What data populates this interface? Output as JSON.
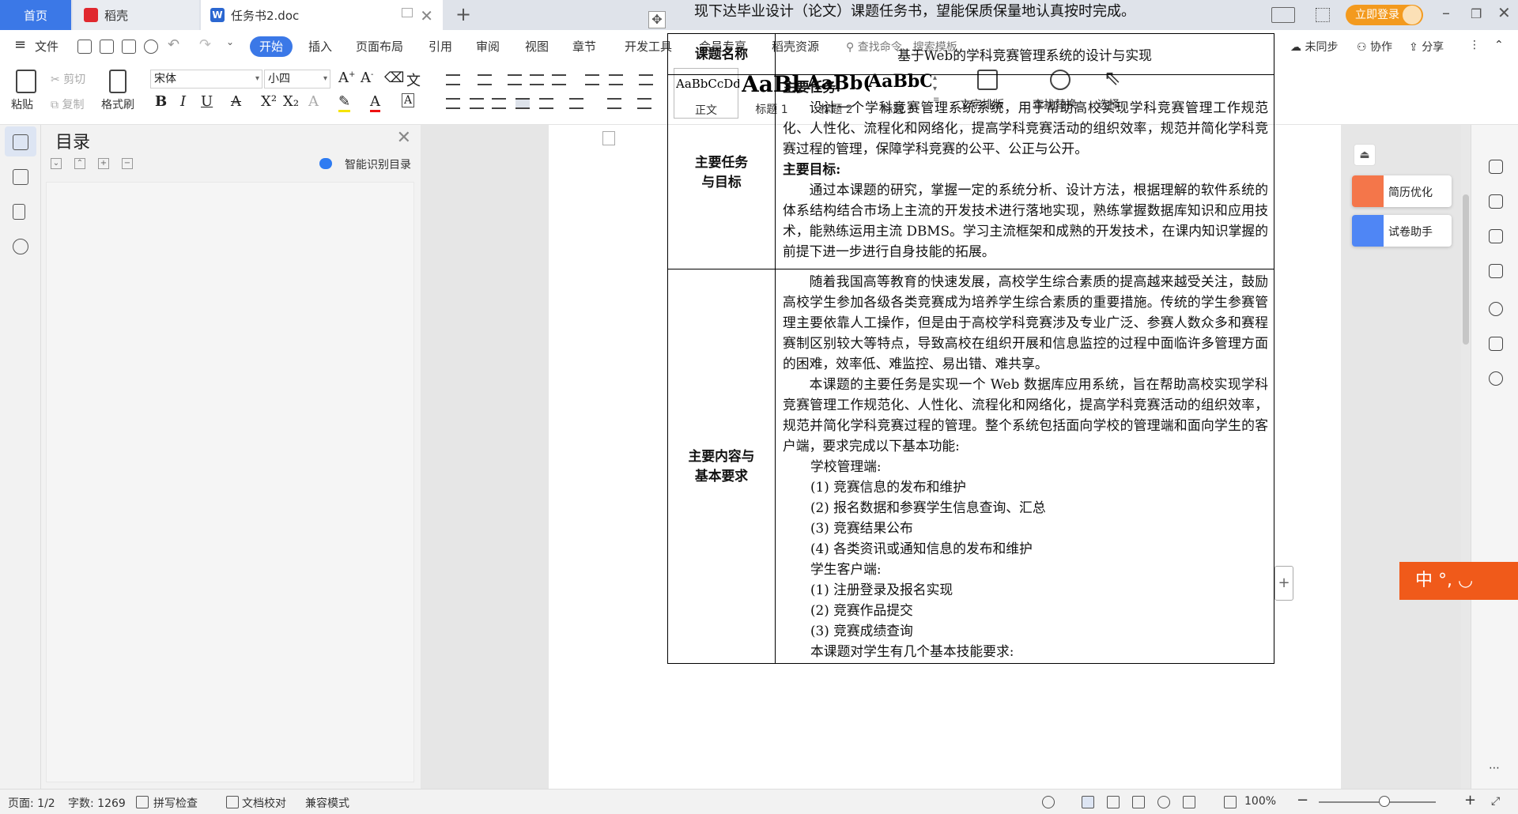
{
  "tabs": {
    "home": "首页",
    "daoke": "稻壳",
    "doc": "任务书2.doc",
    "login": "立即登录"
  },
  "menu": {
    "file": "文件",
    "items": [
      "开始",
      "插入",
      "页面布局",
      "引用",
      "审阅",
      "视图",
      "章节",
      "开发工具",
      "会员专享",
      "稻壳资源"
    ],
    "search_placeholder": "查找命令、搜索模板",
    "sync": "未同步",
    "collab": "协作",
    "share": "分享"
  },
  "ribbon": {
    "paste": "粘贴",
    "cut": "剪切",
    "copy": "复制",
    "format_painter": "格式刷",
    "font_name": "宋体",
    "font_size": "小四",
    "bold": "B",
    "italic": "I",
    "underline": "U",
    "styles": [
      {
        "sample": "AaBbCcDd",
        "caption": "正文"
      },
      {
        "sample": "AaBl",
        "caption": "标题 1"
      },
      {
        "sample": "AaBb(",
        "caption": "标题 2"
      },
      {
        "sample": "AaBbC",
        "caption": "标题 3"
      }
    ],
    "text_layout": "文字排版",
    "find_replace": "查找替换",
    "select": "选择"
  },
  "toc": {
    "title": "目录",
    "smart": "智能识别目录"
  },
  "document": {
    "intro_line": "现下达毕业设计（论文）课题任务书，望能保质保量地认真按时完成。",
    "rows": {
      "topic_label": "课题名称",
      "topic_value": "基于Web的学科竞赛管理系统的设计与实现",
      "task_label_1": "主要任务",
      "task_label_2": "与目标",
      "main_task_head": "主要任务:",
      "main_task_text": "设计一个学科竞赛管理系统系统，用于帮助高校实现学科竞赛管理工作规范化、人性化、流程化和网络化，提高学科竞赛活动的组织效率，规范并简化学科竞赛过程的管理，保障学科竞赛的公平、公正与公开。",
      "main_goal_head": "主要目标:",
      "main_goal_text": "通过本课题的研究，掌握一定的系统分析、设计方法，根据理解的软件系统的体系结构结合市场上主流的开发技术进行落地实现，熟练掌握数据库知识和应用技术，能熟练运用主流 DBMS。学习主流框架和成熟的开发技术，在课内知识掌握的前提下进一步进行自身技能的拓展。",
      "content_label_1": "主要内容与",
      "content_label_2": "基本要求",
      "content_p1": "随着我国高等教育的快速发展，高校学生综合素质的提高越来越受关注，鼓励高校学生参加各级各类竞赛成为培养学生综合素质的重要措施。传统的学生参赛管理主要依靠人工操作，但是由于高校学科竞赛涉及专业广泛、参赛人数众多和赛程赛制区别较大等特点，导致高校在组织开展和信息监控的过程中面临许多管理方面的困难，效率低、难监控、易出错、难共享。",
      "content_p2": "本课题的主要任务是实现一个 Web 数据库应用系统，旨在帮助高校实现学科竞赛管理工作规范化、人性化、流程化和网络化，提高学科竞赛活动的组织效率，规范并简化学科竞赛过程的管理。整个系统包括面向学校的管理端和面向学生的客户端，要求完成以下基本功能:",
      "school_head": "学校管理端:",
      "school_items": [
        "(1)  竞赛信息的发布和维护",
        "(2)  报名数据和参赛学生信息查询、汇总",
        "(3)  竞赛结果公布",
        "(4)  各类资讯或通知信息的发布和维护"
      ],
      "student_head": "学生客户端:",
      "student_items": [
        "(1)  注册登录及报名实现",
        "(2)  竞赛作品提交",
        "(3)  竞赛成绩查询"
      ],
      "req_line": "本课题对学生有几个基本技能要求:"
    }
  },
  "floating": {
    "resume": "简历优化",
    "exam": "试卷助手",
    "ime": "中 °, ◡"
  },
  "status": {
    "page": "页面: 1/2",
    "words": "字数: 1269",
    "spell": "拼写检查",
    "proof": "文档校对",
    "compat": "兼容模式",
    "zoom": "100%"
  }
}
